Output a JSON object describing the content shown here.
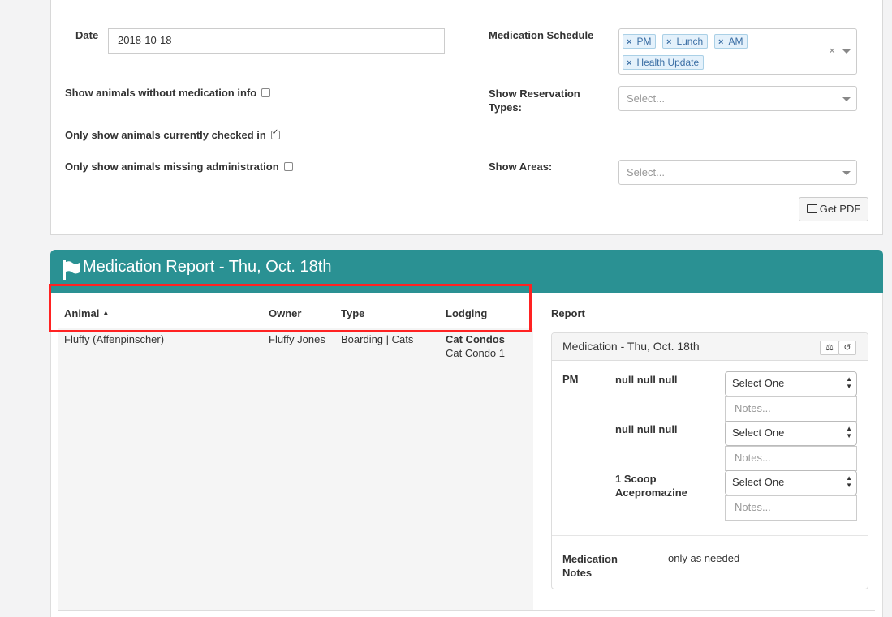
{
  "filters": {
    "date_label": "Date",
    "date_value": "2018-10-18",
    "show_without_med_label": "Show animals without medication info",
    "show_without_med_checked": false,
    "only_checked_in_label": "Only show animals currently checked in",
    "only_checked_in_checked": true,
    "only_missing_admin_label": "Only show animals missing administration",
    "only_missing_admin_checked": false,
    "med_schedule_label": "Medication Schedule",
    "med_schedule_tags": [
      "PM",
      "Lunch",
      "AM",
      "Health Update"
    ],
    "reservation_types_label_1": "Show Reservation",
    "reservation_types_label_2": "Types:",
    "reservation_types_placeholder": "Select...",
    "areas_label": "Show Areas:",
    "areas_placeholder": "Select...",
    "get_pdf_label": "Get PDF"
  },
  "report": {
    "title": "Medication Report - Thu, Oct. 18th",
    "columns": {
      "animal": "Animal",
      "owner": "Owner",
      "type": "Type",
      "lodging": "Lodging",
      "report": "Report"
    },
    "rows": [
      {
        "animal": "Fluffy (Affenpinscher)",
        "owner": "Fluffy Jones",
        "type": "Boarding | Cats",
        "lodging_name": "Cat Condos",
        "lodging_unit": "Cat Condo 1"
      }
    ],
    "medication_panel": {
      "title": "Medication - Thu, Oct. 18th",
      "schedule": "PM",
      "items": [
        {
          "name_1": "null null null",
          "name_2": "",
          "select": "Select One",
          "notes_placeholder": "Notes..."
        },
        {
          "name_1": "null null null",
          "name_2": "",
          "select": "Select One",
          "notes_placeholder": "Notes..."
        },
        {
          "name_1": "1 Scoop",
          "name_2": "Acepromazine",
          "select": "Select One",
          "notes_placeholder": "Notes..."
        }
      ],
      "notes_label_1": "Medication",
      "notes_label_2": "Notes",
      "notes_value": "only as needed"
    }
  },
  "colors": {
    "header_teal": "#2a9193",
    "highlight_red": "#ff2222",
    "tag_blue": "#3c6fa5"
  }
}
